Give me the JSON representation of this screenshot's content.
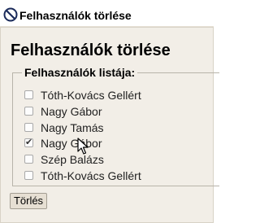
{
  "window": {
    "title": "Felhasználók törlése",
    "icon": "no-entry-icon"
  },
  "main": {
    "heading": "Felhasználók törlése",
    "fieldset_legend": "Felhasználók listája:",
    "users": [
      {
        "label": "Tóth-Kovács Gellért",
        "checked": false
      },
      {
        "label": "Nagy Gábor",
        "checked": false
      },
      {
        "label": "Nagy Tamás",
        "checked": false
      },
      {
        "label": "Nagy Gábor",
        "checked": true
      },
      {
        "label": "Szép Balázs",
        "checked": false
      },
      {
        "label": "Tóth-Kovács Gellért",
        "checked": false
      }
    ],
    "delete_button": "Törlés"
  }
}
